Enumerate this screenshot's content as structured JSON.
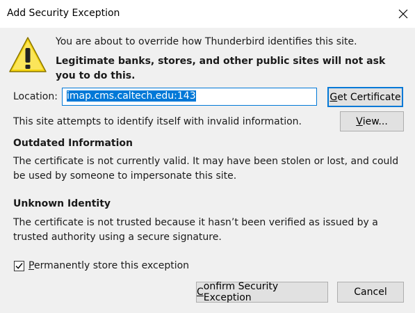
{
  "window": {
    "title": "Add Security Exception"
  },
  "dialog": {
    "intro": "You are about to override how Thunderbird identifies this site.",
    "warning": "Legitimate banks, stores, and other public sites will not ask you to do this.",
    "location_label_pre": "Location:",
    "location_value": "imap.cms.caltech.edu:143",
    "get_certificate_pre": "G",
    "get_certificate_rest": "et Certificate",
    "site_status": "This site attempts to identify itself with invalid information.",
    "view_button_pre": "V",
    "view_button_rest": "iew...",
    "outdated_title": "Outdated Information",
    "outdated_text": "The certificate is not currently valid. It may have been stolen or lost, and could be used by someone to impersonate this site.",
    "unknown_title": "Unknown Identity",
    "unknown_text": "The certificate is not trusted because it hasn’t been verified as issued by a trusted authority using a secure signature.",
    "permanent_checked": true,
    "permanent_label_pre": "P",
    "permanent_label_rest": "ermanently store this exception",
    "confirm_pre": "C",
    "confirm_rest": "onfirm Security Exception",
    "cancel_label": "Cancel"
  },
  "icons": {
    "warning": "warning-icon",
    "close": "close-icon",
    "check": "checkmark-icon"
  },
  "colors": {
    "accent": "#0078d7",
    "warning_yellow": "#f5d40f"
  }
}
